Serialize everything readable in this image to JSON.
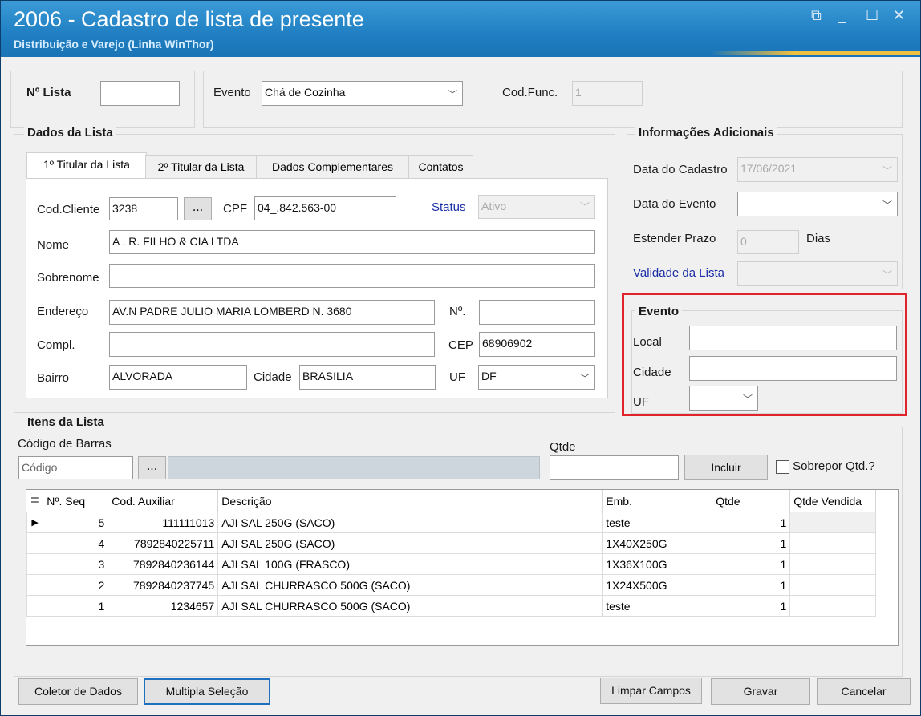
{
  "window": {
    "title": "2006 - Cadastro de lista de presente",
    "subtitle": "Distribuição e Varejo (Linha WinThor)",
    "controls": {
      "restore": "⧉",
      "minimize": "_",
      "maximize": "☐",
      "close": "✕"
    }
  },
  "header": {
    "nro_lista_label": "Nº Lista",
    "nro_lista_value": "",
    "evento_label": "Evento",
    "evento_value": "Chá de Cozinha",
    "codfunc_label": "Cod.Func.",
    "codfunc_value": "1"
  },
  "dados_lista": {
    "title": "Dados da Lista",
    "tabs": [
      "1º Titular da Lista",
      "2º Titular da Lista",
      "Dados Complementares",
      "Contatos"
    ],
    "cod_cliente_label": "Cod.Cliente",
    "cod_cliente_value": "3238",
    "browse_label": "...",
    "cpf_label": "CPF",
    "cpf_value": "04_.842.563-00",
    "status_label": "Status",
    "status_value": "Ativo",
    "nome_label": "Nome",
    "nome_value": "A . R.  FILHO & CIA LTDA",
    "sobrenome_label": "Sobrenome",
    "sobrenome_value": "",
    "endereco_label": "Endereço",
    "endereco_value": "AV.N PADRE  JULIO  MARIA LOMBERD N. 3680",
    "numero_label": "Nº.",
    "numero_value": "",
    "compl_label": "Compl.",
    "compl_value": "",
    "cep_label": "CEP",
    "cep_value": "68906902",
    "bairro_label": "Bairro",
    "bairro_value": "ALVORADA",
    "cidade_label": "Cidade",
    "cidade_value": "BRASILIA",
    "uf_label": "UF",
    "uf_value": "DF"
  },
  "info_adicionais": {
    "title": "Informações Adicionais",
    "data_cadastro_label": "Data do Cadastro",
    "data_cadastro_value": "17/06/2021",
    "data_evento_label": "Data do Evento",
    "data_evento_value": "",
    "estender_label": "Estender Prazo",
    "estender_value": "0",
    "dias_label": "Dias",
    "validade_label": "Validade da Lista",
    "validade_value": ""
  },
  "evento_group": {
    "title": "Evento",
    "local_label": "Local",
    "local_value": "",
    "cidade_label": "Cidade",
    "cidade_value": "",
    "uf_label": "UF",
    "uf_value": ""
  },
  "itens": {
    "title": "Itens da Lista",
    "codigo_barras_label": "Código de Barras",
    "codigo_placeholder": "Código",
    "browse_label": "...",
    "qtde_label": "Qtde",
    "qtde_value": "",
    "incluir_label": "Incluir",
    "sobrepor_label": "Sobrepor Qtd.?",
    "columns": [
      "Nº. Seq",
      "Cod. Auxiliar",
      "Descrição",
      "Emb.",
      "Qtde",
      "Qtde Vendida"
    ],
    "rows": [
      {
        "seq": "5",
        "cod": "111111013",
        "desc": "AJI SAL 250G (SACO)",
        "emb": "teste",
        "qtde": "1",
        "vendida": ""
      },
      {
        "seq": "4",
        "cod": "7892840225711",
        "desc": "AJI SAL 250G (SACO)",
        "emb": "1X40X250G",
        "qtde": "1",
        "vendida": ""
      },
      {
        "seq": "3",
        "cod": "7892840236144",
        "desc": "AJI SAL 100G (FRASCO)",
        "emb": "1X36X100G",
        "qtde": "1",
        "vendida": ""
      },
      {
        "seq": "2",
        "cod": "7892840237745",
        "desc": "AJI SAL CHURRASCO 500G (SACO)",
        "emb": "1X24X500G",
        "qtde": "1",
        "vendida": ""
      },
      {
        "seq": "1",
        "cod": "1234657",
        "desc": "AJI SAL CHURRASCO 500G (SACO)",
        "emb": "teste",
        "qtde": "1",
        "vendida": ""
      }
    ]
  },
  "footer": {
    "coletor_label": "Coletor de Dados",
    "multipla_label": "Multipla Seleção",
    "limpar_label": "Limpar Campos",
    "gravar_label": "Gravar",
    "cancelar_label": "Cancelar"
  }
}
